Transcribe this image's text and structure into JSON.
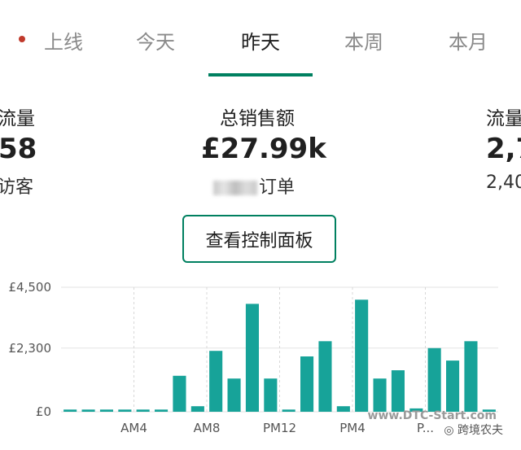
{
  "tabs": [
    {
      "label": "上线",
      "active": false,
      "live_indicator": true
    },
    {
      "label": "今天",
      "active": false
    },
    {
      "label": "昨天",
      "active": true
    },
    {
      "label": "本周",
      "active": false
    },
    {
      "label": "本月",
      "active": false
    }
  ],
  "metrics": {
    "left": {
      "label": "流量",
      "value": "58",
      "sub": "访客"
    },
    "center": {
      "label": "总销售额",
      "value": "£27.99k",
      "sub_suffix": "订单"
    },
    "right": {
      "label": "流量",
      "value": "2,7",
      "sub": "2,40"
    }
  },
  "dashboard_button": {
    "label": "查看控制面板"
  },
  "colors": {
    "accent": "#008060",
    "bar": "#17a399",
    "live_dot": "#c0392b"
  },
  "chart_data": {
    "type": "bar",
    "y_tick_labels": [
      "£4,500",
      "£2,300",
      "£0"
    ],
    "y_ticks": [
      4500,
      2300,
      0
    ],
    "ylim": [
      0,
      4500
    ],
    "x_tick_labels": [
      "AM4",
      "AM8",
      "PM12",
      "PM4",
      "P..."
    ],
    "x_tick_hours": [
      4,
      8,
      12,
      16,
      20
    ],
    "categories": [
      "0",
      "1",
      "2",
      "3",
      "4",
      "5",
      "6",
      "7",
      "8",
      "9",
      "10",
      "11",
      "12",
      "13",
      "14",
      "15",
      "16",
      "17",
      "18",
      "19",
      "20",
      "21",
      "22",
      "23"
    ],
    "values": [
      80,
      80,
      80,
      80,
      80,
      80,
      1300,
      200,
      2200,
      1200,
      3900,
      1200,
      80,
      2000,
      2550,
      200,
      4050,
      1200,
      1500,
      120,
      2300,
      1850,
      2550,
      80
    ]
  },
  "watermark": {
    "line1": "www.DTC-Start.com",
    "line2": "跨境农夫"
  }
}
